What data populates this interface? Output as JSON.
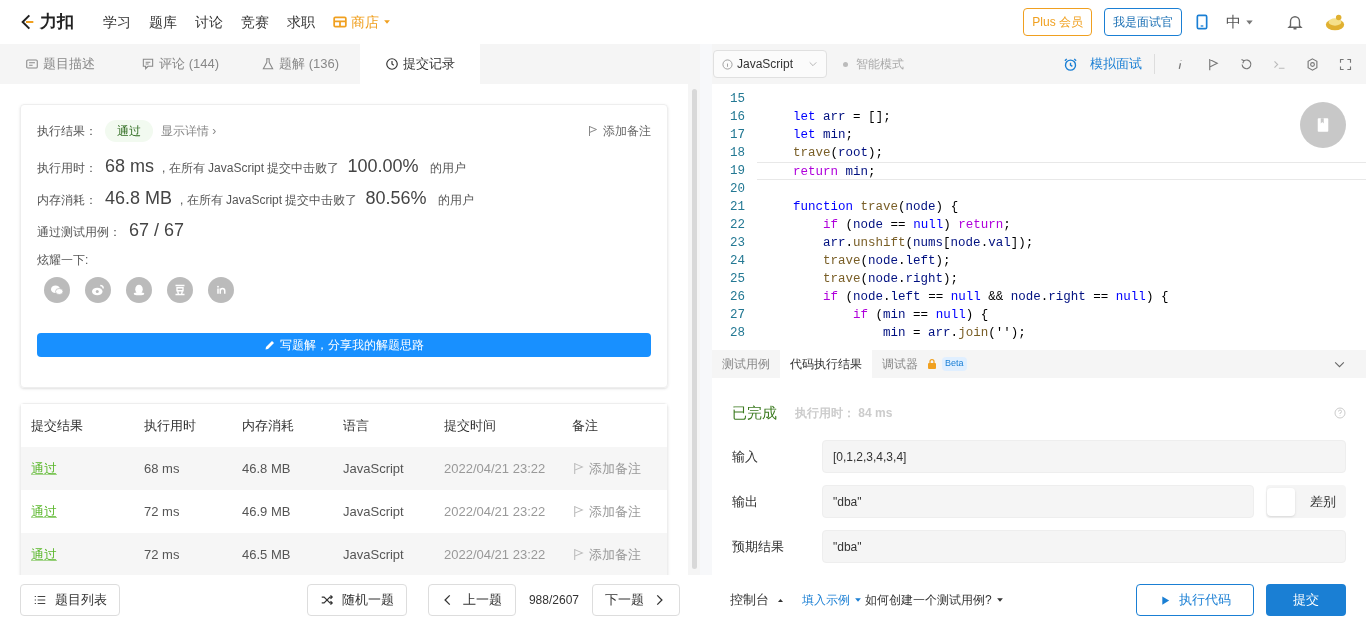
{
  "nav": {
    "logo": "力扣",
    "items": [
      {
        "label": "学习",
        "kind": "plain"
      },
      {
        "label": "题库",
        "kind": "plain"
      },
      {
        "label": "讨论",
        "kind": "plain"
      },
      {
        "label": "竞赛",
        "kind": "plain"
      },
      {
        "label": "求职",
        "kind": "plain"
      },
      {
        "label": "商店",
        "kind": "shop"
      }
    ],
    "plus": "Plus 会员",
    "interviewer": "我是面试官",
    "language": "中"
  },
  "left_tabs": [
    {
      "label": "题目描述",
      "selected": false
    },
    {
      "label": "评论",
      "count": "(144)",
      "selected": false
    },
    {
      "label": "题解",
      "count": "(136)",
      "selected": false
    },
    {
      "label": "提交记录",
      "selected": true
    }
  ],
  "result": {
    "label": "执行结果：",
    "status": "通过",
    "details": "显示详情 ›",
    "add_note": "添加备注",
    "stats": [
      {
        "label": "执行用时：",
        "value": "68 ms",
        "mid": ", 在所有 JavaScript 提交中击败了",
        "percent": "100.00%",
        "suffix": "的用户"
      },
      {
        "label": "内存消耗：",
        "value": "46.8 MB",
        "mid": ", 在所有 JavaScript 提交中击败了",
        "percent": "80.56%",
        "suffix": "的用户"
      }
    ],
    "cases_label": "通过测试用例：",
    "cases": "67 / 67",
    "share_label": "炫耀一下:",
    "write_button": "写题解，分享我的解题思路"
  },
  "table": {
    "columns": [
      "提交结果",
      "执行用时",
      "内存消耗",
      "语言",
      "提交时间",
      "备注"
    ],
    "rows": [
      {
        "result": "通过",
        "time": "68 ms",
        "memory": "46.8 MB",
        "language": "JavaScript",
        "submitted": "2022/04/21 23:22",
        "note": "添加备注"
      },
      {
        "result": "通过",
        "time": "72 ms",
        "memory": "46.9 MB",
        "language": "JavaScript",
        "submitted": "2022/04/21 23:22",
        "note": "添加备注"
      },
      {
        "result": "通过",
        "time": "72 ms",
        "memory": "46.5 MB",
        "language": "JavaScript",
        "submitted": "2022/04/21 23:22",
        "note": "添加备注"
      }
    ]
  },
  "editor": {
    "language": "JavaScript",
    "smart_mode": "智能模式",
    "mock": "模拟面试",
    "lines": [
      {
        "number": "15",
        "selected": false
      },
      {
        "number": "16",
        "selected": false,
        "code": "    let arr = [];"
      },
      {
        "number": "17",
        "selected": false,
        "code": "    let min;"
      },
      {
        "number": "18",
        "selected": false,
        "code": "    trave(root);"
      },
      {
        "number": "19",
        "selected": true,
        "code": "    return min;"
      },
      {
        "number": "20",
        "selected": false
      },
      {
        "number": "21",
        "selected": false,
        "code": "    function trave(node) {"
      },
      {
        "number": "22",
        "selected": false,
        "code": "        if (node == null) return;"
      },
      {
        "number": "23",
        "selected": false,
        "code": "        arr.unshift(nums[node.val]);"
      },
      {
        "number": "24",
        "selected": false,
        "code": "        trave(node.left);"
      },
      {
        "number": "25",
        "selected": false,
        "code": "        trave(node.right);"
      },
      {
        "number": "26",
        "selected": false,
        "code": "        if (node.left == null && node.right == null) {"
      },
      {
        "number": "27",
        "selected": false,
        "code": "            if (min == null) {"
      },
      {
        "number": "28",
        "selected": false,
        "code": "                min = arr.join('');"
      }
    ]
  },
  "console": {
    "tabs": [
      {
        "label": "测试用例",
        "selected": false
      },
      {
        "label": "代码执行结果",
        "selected": true
      },
      {
        "label": "调试器",
        "selected": false,
        "badge": "Beta"
      }
    ],
    "status": "已完成",
    "time": "执行用时： 84 ms",
    "fields": [
      {
        "label": "输入",
        "value": "[0,1,2,3,4,3,4]"
      },
      {
        "label": "输出",
        "value": "\"dba\"",
        "diff": "差别",
        "diff_on": false
      },
      {
        "label": "预期结果",
        "value": "\"dba\""
      }
    ]
  },
  "footer": {
    "list": "题目列表",
    "random": "随机一题",
    "prev": "上一题",
    "progress": "988/2607",
    "next": "下一题",
    "console": "控制台",
    "fill_example": "填入示例",
    "howto": "如何创建一个测试用例?",
    "run": "执行代码",
    "submit": "提交"
  }
}
